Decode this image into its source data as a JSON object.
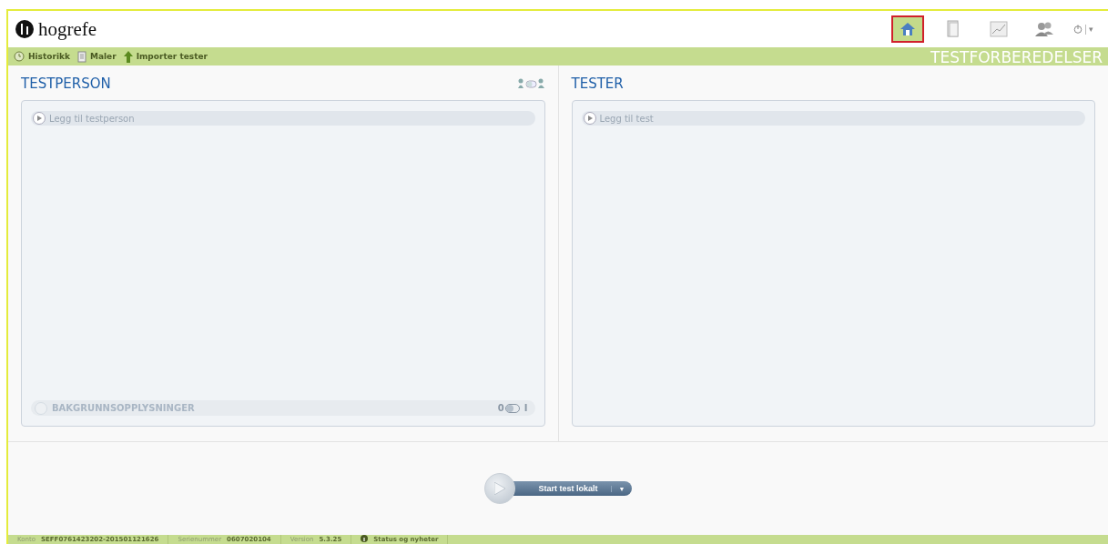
{
  "logo": {
    "text": "hogrefe"
  },
  "nav_icons": [
    {
      "kind": "home",
      "selected": true
    },
    {
      "kind": "tests",
      "selected": false
    },
    {
      "kind": "chart",
      "selected": false
    },
    {
      "kind": "users",
      "selected": false
    }
  ],
  "power_menu": {
    "caret": "▾"
  },
  "toolbar": [
    {
      "kind": "history",
      "label": "Historikk"
    },
    {
      "kind": "document",
      "label": "Maler"
    },
    {
      "kind": "upload",
      "label": "Importer tester"
    }
  ],
  "section_title": "TESTFORBEREDELSER",
  "testperson": {
    "title": "TESTPERSON",
    "add_label": "Legg til testperson",
    "background": {
      "label": "BAKGRUNNSOPPLYSNINGER",
      "off_label": "0",
      "on_label": "I",
      "on": false
    }
  },
  "tester": {
    "title": "TESTER",
    "add_label": "Legg til test"
  },
  "start_button": {
    "label": "Start test lokalt",
    "caret": "▼"
  },
  "status_bar": [
    {
      "kind": "pair",
      "label": "Konto",
      "value": "SEFF0761423202-201501121626"
    },
    {
      "kind": "pair",
      "label": "Serienummer",
      "value": "0607020104"
    },
    {
      "kind": "pair",
      "label": "Version",
      "value": "5.3.25"
    },
    {
      "kind": "link",
      "value": "Status og nyheter"
    }
  ]
}
